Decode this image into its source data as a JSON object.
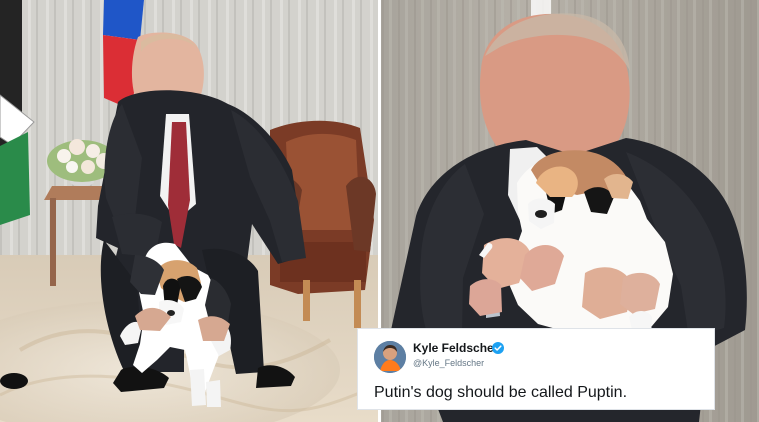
{
  "images": {
    "left_photo": {
      "description": "Man in dark suit lifting a puppy in a formal room"
    },
    "right_photo": {
      "description": "Man in dark suit holding a puppy close to his chest"
    }
  },
  "tweet": {
    "name": "Kyle Feldscher",
    "handle": "@Kyle_Feldscher",
    "text": "Putin's dog should be called Puptin.",
    "verified": true,
    "colors": {
      "verified": "#1da1f2",
      "name": "#14171a",
      "handle": "#657786",
      "border": "#dfe3e8"
    }
  }
}
